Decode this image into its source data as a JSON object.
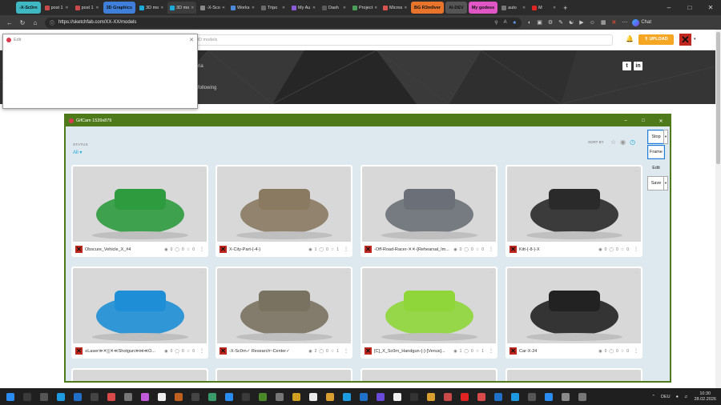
{
  "browser": {
    "tabs": [
      {
        "label": "-X-Sc0rn",
        "color": "#3fb8c4",
        "group": true
      },
      {
        "label": "post 1",
        "color": "#c94a4a"
      },
      {
        "label": "post 1",
        "color": "#c94a4a"
      },
      {
        "label": "3D Graphics",
        "color": "#3f7fd9",
        "group": true
      },
      {
        "label": "3D mo",
        "color": "#1caad9"
      },
      {
        "label": "3D mo",
        "color": "#1caad9",
        "active": true
      },
      {
        "label": "-X-Sco",
        "color": "#888888"
      },
      {
        "label": "Works",
        "color": "#4a8ad9"
      },
      {
        "label": "Tripo",
        "color": "#6a6a6a"
      },
      {
        "label": "My Au",
        "color": "#8a5ad9"
      },
      {
        "label": "Dash",
        "color": "#5a5a5a"
      },
      {
        "label": "Project",
        "color": "#4aa05a"
      },
      {
        "label": "Micros",
        "color": "#d9534f"
      },
      {
        "label": "BG R3m0ver",
        "color": "#e8742c",
        "group": true
      },
      {
        "label": "AI-DEV",
        "color": "#555555",
        "group": true
      },
      {
        "label": "My godess",
        "color": "#e056c4",
        "group": true
      },
      {
        "label": "auto",
        "color": "#777777"
      },
      {
        "label": "M",
        "color": "#e02424"
      }
    ],
    "url": "https://sketchfab.com/XX-XX/models",
    "chat_label": "Chat"
  },
  "sketchfab": {
    "search_placeholder": "3D models",
    "upload_label": "UPLOAD",
    "banner_fragments": [
      "ria",
      "following"
    ]
  },
  "edit_window": {
    "title": "Edit"
  },
  "gifcam": {
    "title": "GifCam 1539x879",
    "buttons": [
      "Stop",
      "Frame",
      "Edit",
      "Save"
    ]
  },
  "filters": {
    "status_label": "STATUS",
    "status_value": "All",
    "sort_by_label": "SORT BY"
  },
  "models": [
    {
      "name": "Obscure_Vehicle_X_#4",
      "views": "0",
      "comments": "0",
      "likes": "0",
      "thumb": "#2e9b3f"
    },
    {
      "name": "X-City-Part-{-4-}",
      "views": "1",
      "comments": "0",
      "likes": "1",
      "thumb": "#8a7a62"
    },
    {
      "name": "-Off-Road-Racer-✕✕-[Rehearsal_Im...",
      "views": "0",
      "comments": "0",
      "likes": "0",
      "thumb": "#6b7078"
    },
    {
      "name": "Kitt-{-8-}-Χ",
      "views": "0",
      "comments": "0",
      "likes": "0",
      "thumb": "#2a2a2a"
    },
    {
      "name": "≡Laser≫✕▒✕≪Shotgun≫⋈≪O...",
      "views": "0",
      "comments": "0",
      "likes": "0",
      "thumb": "#1e8fd6"
    },
    {
      "name": "-X-Sc0rn✓ Research~Center✓",
      "views": "2",
      "comments": "0",
      "likes": "1",
      "thumb": "#7a7260"
    },
    {
      "name": "[C]_X_Sc0rn_Handgun-{-}-[Venus]...",
      "views": "1",
      "comments": "0",
      "likes": "1",
      "thumb": "#8fd63a"
    },
    {
      "name": "Car-X-24",
      "views": "0",
      "comments": "0",
      "likes": "0",
      "thumb": "#222222"
    }
  ],
  "taskbar": {
    "lang": "DEU",
    "time": "10:30",
    "date": "28.02.2026"
  }
}
